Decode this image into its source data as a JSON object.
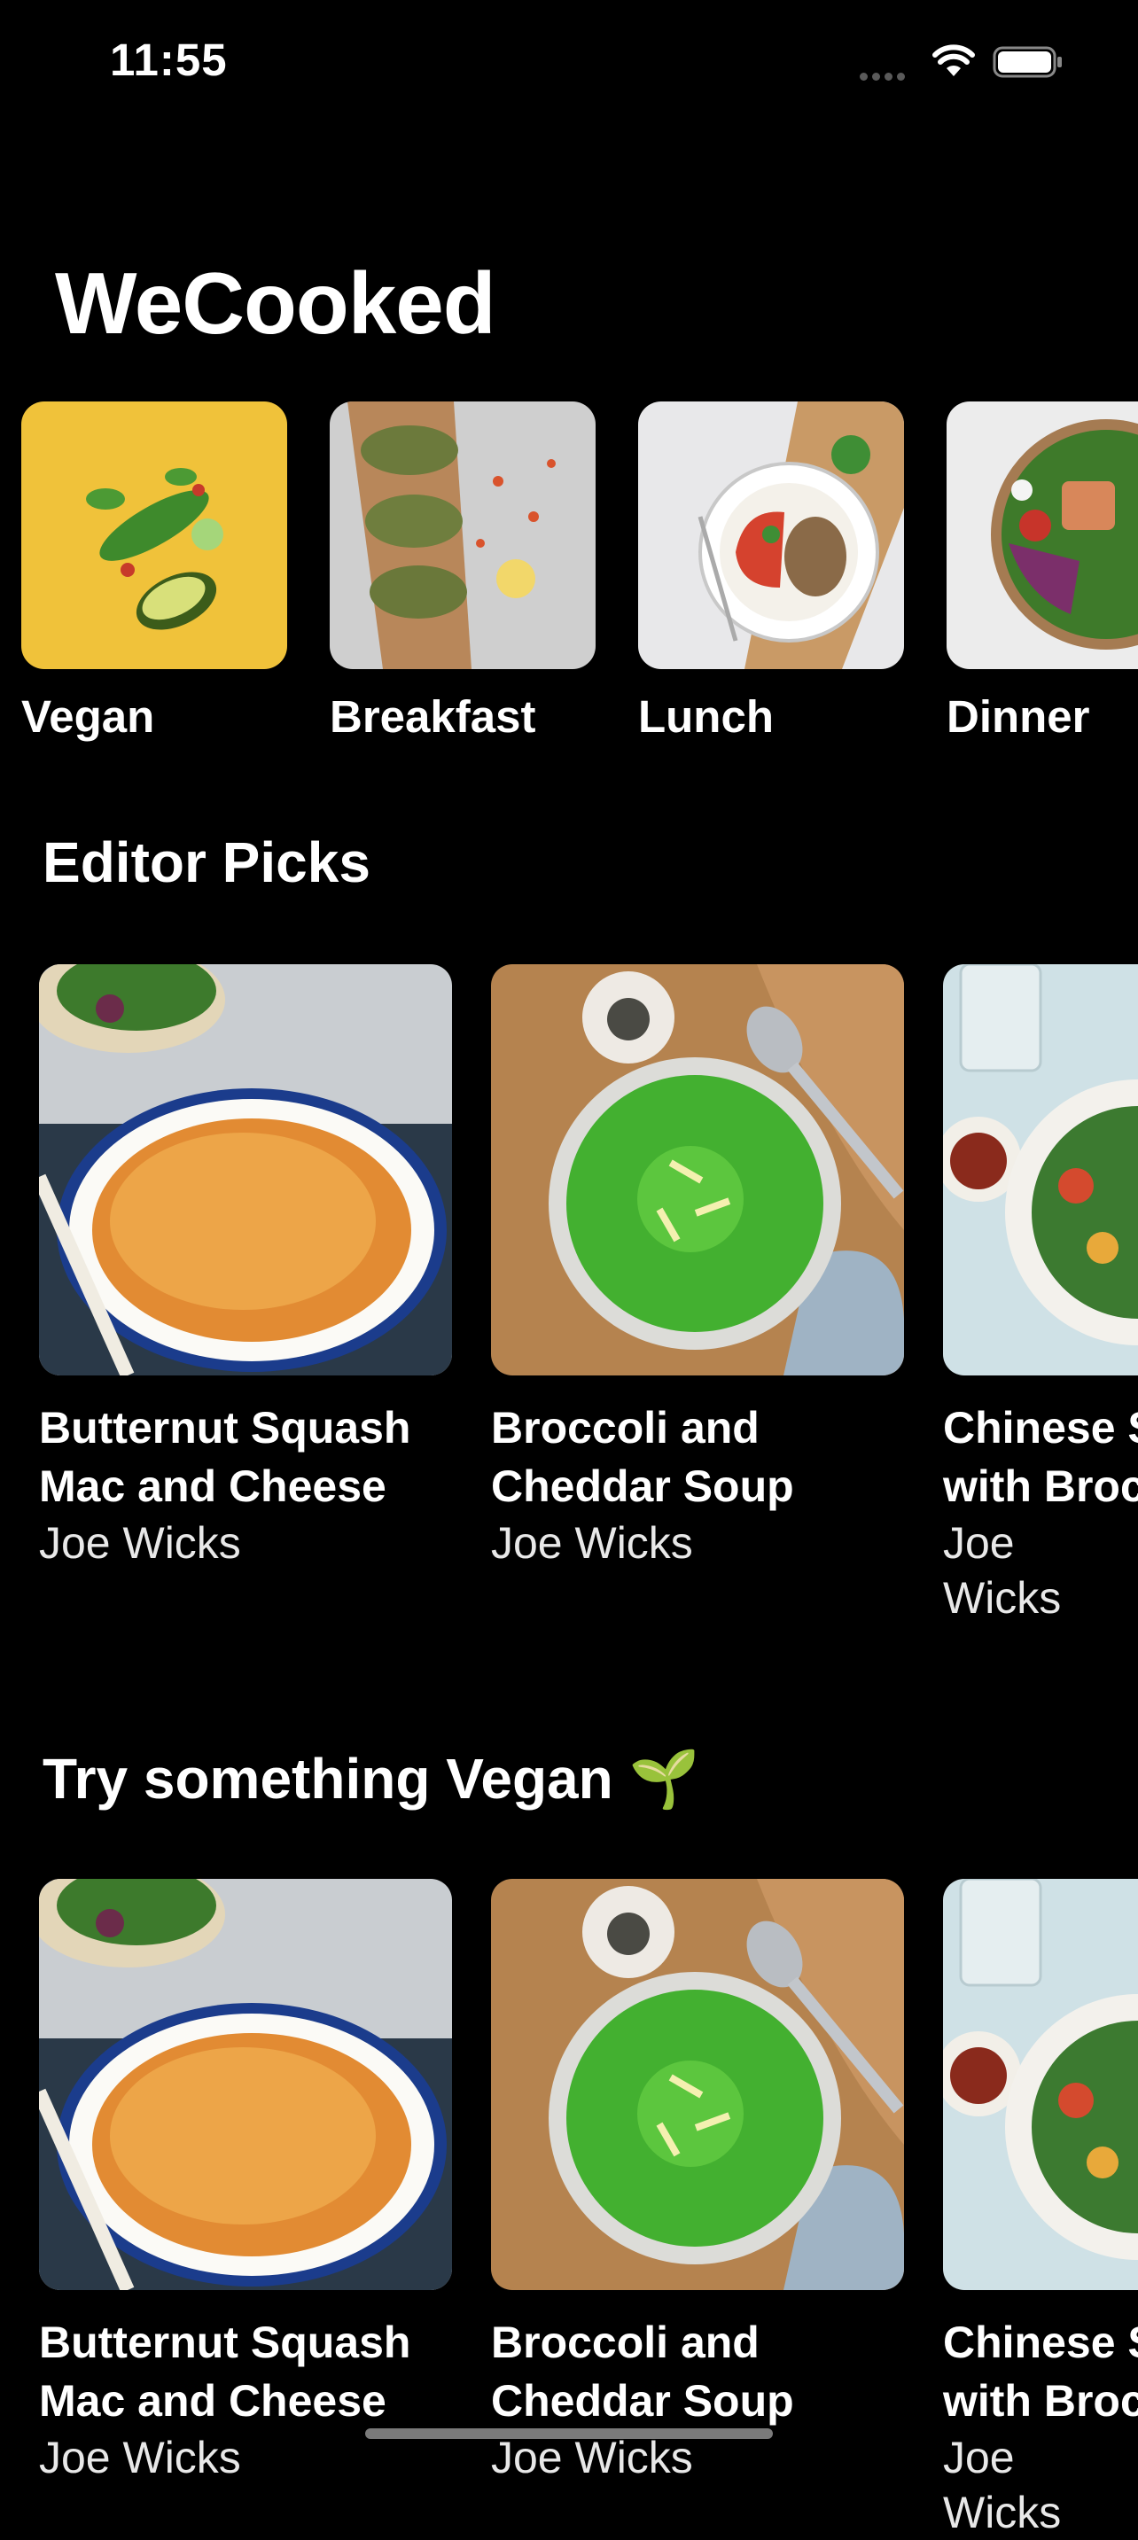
{
  "status_bar": {
    "time": "11:55"
  },
  "app_title": "WeCooked",
  "categories": [
    {
      "label": "Vegan"
    },
    {
      "label": "Breakfast"
    },
    {
      "label": "Lunch"
    },
    {
      "label": "Dinner"
    }
  ],
  "sections": [
    {
      "title": "Editor Picks",
      "recipes": [
        {
          "name": "Butternut Squash\nMac and Cheese",
          "author": "Joe Wicks"
        },
        {
          "name": "Broccoli and\nCheddar Soup",
          "author": "Joe Wicks"
        },
        {
          "name": "Chinese S\nwith Broc",
          "author": "Joe Wicks"
        }
      ]
    },
    {
      "title": "Try something Vegan 🌱",
      "recipes": [
        {
          "name": "Butternut Squash\nMac and Cheese",
          "author": "Joe Wicks"
        },
        {
          "name": "Broccoli and\nCheddar Soup",
          "author": "Joe Wicks"
        },
        {
          "name": "Chinese S\nwith Broc",
          "author": "Joe Wicks"
        }
      ]
    }
  ],
  "colors": {
    "background": "#000000",
    "text": "#ffffff"
  }
}
